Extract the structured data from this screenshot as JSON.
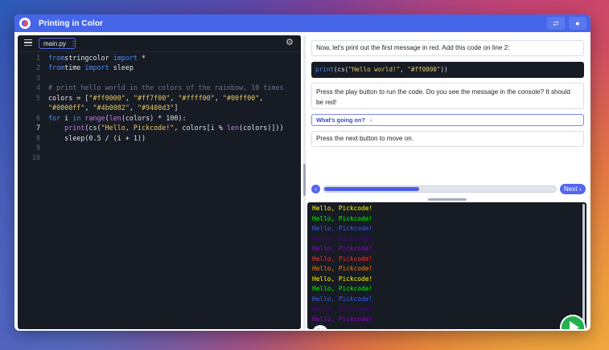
{
  "app": {
    "title": "Printing in Color"
  },
  "editor": {
    "file_tab": "main.py",
    "lines": [
      {
        "n": "1",
        "html_tokens": [
          [
            "kw",
            "from"
          ],
          [
            "",
            "stringcolor "
          ],
          [
            "kw",
            "import"
          ],
          [
            "",
            " *"
          ]
        ]
      },
      {
        "n": "2",
        "html_tokens": [
          [
            "kw",
            "from"
          ],
          [
            "",
            "time "
          ],
          [
            "kw",
            "import"
          ],
          [
            "",
            " sleep"
          ]
        ]
      },
      {
        "n": "3",
        "html_tokens": []
      },
      {
        "n": "4",
        "html_tokens": [
          [
            "cm",
            "# print hello world in the colors of the rainbow, 10 times"
          ]
        ]
      },
      {
        "n": "5",
        "html_tokens": [
          [
            "",
            "colors = ["
          ],
          [
            "str",
            "\"#ff0000\""
          ],
          [
            "",
            ", "
          ],
          [
            "str",
            "\"#ff7f00\""
          ],
          [
            "",
            ", "
          ],
          [
            "str",
            "\"#ffff00\""
          ],
          [
            "",
            ", "
          ],
          [
            "str",
            "\"#00ff00\""
          ],
          [
            "",
            ","
          ]
        ]
      },
      {
        "n": "",
        "html_tokens": [
          [
            "str",
            "\"#0000ff\""
          ],
          [
            "",
            ", "
          ],
          [
            "str",
            "\"#4b0082\""
          ],
          [
            "",
            ", "
          ],
          [
            "str",
            "\"#9400d3\""
          ],
          [
            "",
            "]"
          ]
        ]
      },
      {
        "n": "6",
        "html_tokens": [
          [
            "kw",
            "for"
          ],
          [
            "",
            " i "
          ],
          [
            "kw",
            "in"
          ],
          [
            "",
            " "
          ],
          [
            "fn",
            "range"
          ],
          [
            "",
            "("
          ],
          [
            "fn",
            "len"
          ],
          [
            "",
            "(colors) * 100):"
          ]
        ]
      },
      {
        "n": "7",
        "html_tokens": [
          [
            "",
            "    "
          ],
          [
            "fn",
            "print"
          ],
          [
            "",
            "(cs("
          ],
          [
            "str",
            "\"Hello, Pickcode!\""
          ],
          [
            "",
            ", colors[i % "
          ],
          [
            "fn",
            "len"
          ],
          [
            "",
            "(colors)]))"
          ]
        ]
      },
      {
        "n": "8",
        "html_tokens": [
          [
            "",
            "    sleep(0.5 / (i + 1))"
          ]
        ]
      },
      {
        "n": "9",
        "html_tokens": []
      },
      {
        "n": "10",
        "html_tokens": []
      }
    ],
    "active_line": "7"
  },
  "instructions": {
    "step1": "Now, let's print out the first message in red. Add this code on line 2:",
    "code_snippet": "print(cs(\"Hello world!\", \"#ff0000\"))",
    "step2": "Press the play button to run the code. Do you see the message in the console? It should be red!",
    "whats_going_on": "What's going on?",
    "step3": "Press the next button to move on.",
    "next_label": "Next",
    "progress": 0.41
  },
  "console": {
    "lines": [
      {
        "text": "Hello, Pickcode!",
        "color": "#ffff00"
      },
      {
        "text": "Hello, Pickcode!",
        "color": "#00ff00"
      },
      {
        "text": "Hello, Pickcode!",
        "color": "#3a5cff"
      },
      {
        "text": "Hello, Pickcode!",
        "color": "#4b0082"
      },
      {
        "text": "Hello, Pickcode!",
        "color": "#9400d3"
      },
      {
        "text": "Hello, Pickcode!",
        "color": "#ff3030"
      },
      {
        "text": "Hello, Pickcode!",
        "color": "#ff7f00"
      },
      {
        "text": "Hello, Pickcode!",
        "color": "#ffff00"
      },
      {
        "text": "Hello, Pickcode!",
        "color": "#00ff00"
      },
      {
        "text": "Hello, Pickcode!",
        "color": "#3a5cff"
      },
      {
        "text": "Hello, Pickcode!",
        "color": "#4b0082"
      },
      {
        "text": "Hello, Pickcode!",
        "color": "#9400d3"
      }
    ]
  },
  "colors": {
    "accent": "#4566e8",
    "play": "#25b04f",
    "editor_bg": "#171b24"
  },
  "icons": {
    "logo": "pickcode-logo-icon",
    "share": "share-icon",
    "user": "user-icon",
    "menu": "menu-icon",
    "settings": "gear-icon",
    "prev": "chevron-left-icon",
    "expand": "expand-icon",
    "play": "play-icon"
  }
}
